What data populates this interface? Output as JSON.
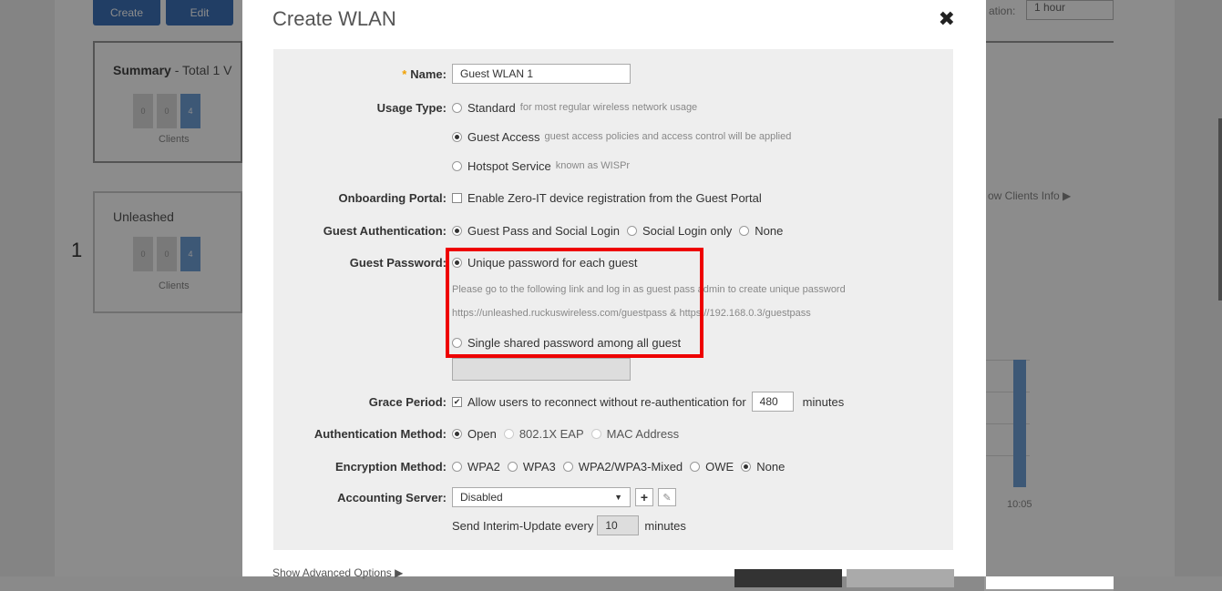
{
  "background": {
    "buttons": [
      "Create",
      "Edit"
    ],
    "summary_title": "Summary",
    "summary_suffix": "- Total 1 V",
    "summary_stats": [
      "0",
      "0",
      "4"
    ],
    "summary_label": "Clients",
    "network_name": "Unleashed",
    "network_index": "1",
    "network_stats": [
      "0",
      "0",
      "4"
    ],
    "network_label": "Clients",
    "duration_label": "ation:",
    "duration_value": "1 hour",
    "show_clients": "ow Clients Info",
    "chart_time": "10:05"
  },
  "modal": {
    "title": "Create WLAN",
    "close_icon": "close-x-icon",
    "name": {
      "label": "Name:",
      "required_mark": "*",
      "value": "Guest WLAN 1"
    },
    "usage_type": {
      "label": "Usage Type:",
      "options": [
        {
          "label": "Standard",
          "hint": "for most regular wireless network usage",
          "selected": false
        },
        {
          "label": "Guest Access",
          "hint": "guest access policies and access control will be applied",
          "selected": true
        },
        {
          "label": "Hotspot Service",
          "hint": "known as WISPr",
          "selected": false
        }
      ]
    },
    "onboarding_portal": {
      "label": "Onboarding Portal:",
      "checkbox_label": "Enable Zero-IT device registration from the Guest Portal",
      "checked": false
    },
    "guest_auth": {
      "label": "Guest Authentication:",
      "options": [
        {
          "label": "Guest Pass and Social Login",
          "selected": true
        },
        {
          "label": "Social Login only",
          "selected": false
        },
        {
          "label": "None",
          "selected": false
        }
      ]
    },
    "guest_password": {
      "label": "Guest Password:",
      "unique_label": "Unique password for each guest",
      "info_line1": "Please go to the following link and log in as guest pass admin to create unique password",
      "info_line2": "https://unleashed.ruckuswireless.com/guestpass & https://192.168.0.3/guestpass",
      "shared_label": "Single shared password among all guest"
    },
    "grace_period": {
      "label": "Grace Period:",
      "checkbox_label": "Allow users to reconnect without re-authentication for",
      "value": "480",
      "unit": "minutes",
      "checked": true
    },
    "auth_method": {
      "label": "Authentication Method:",
      "options": [
        {
          "label": "Open",
          "selected": true
        },
        {
          "label": "802.1X EAP",
          "selected": false
        },
        {
          "label": "MAC Address",
          "selected": false
        }
      ]
    },
    "encryption": {
      "label": "Encryption Method:",
      "options": [
        {
          "label": "WPA2",
          "selected": false
        },
        {
          "label": "WPA3",
          "selected": false
        },
        {
          "label": "WPA2/WPA3-Mixed",
          "selected": false
        },
        {
          "label": "OWE",
          "selected": false
        },
        {
          "label": "None",
          "selected": true
        }
      ]
    },
    "accounting": {
      "label": "Accounting Server:",
      "value": "Disabled",
      "interim_prefix": "Send Interim-Update every",
      "interim_value": "10",
      "interim_unit": "minutes"
    },
    "advanced_link": "Show Advanced Options ▶"
  }
}
